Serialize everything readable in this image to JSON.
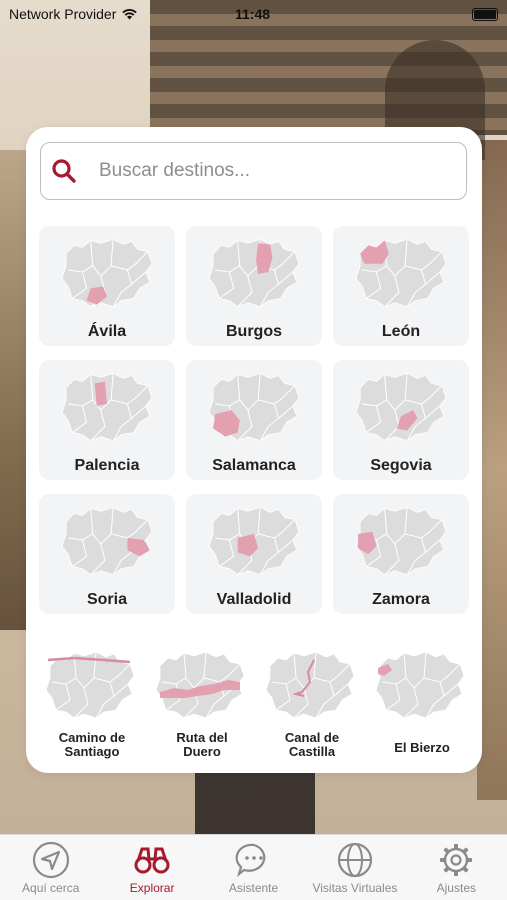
{
  "status_bar": {
    "carrier": "Network Provider",
    "time": "11:48"
  },
  "search": {
    "placeholder": "Buscar destinos..."
  },
  "provinces": [
    {
      "label": "Ávila"
    },
    {
      "label": "Burgos"
    },
    {
      "label": "León"
    },
    {
      "label": "Palencia"
    },
    {
      "label": "Salamanca"
    },
    {
      "label": "Segovia"
    },
    {
      "label": "Soria"
    },
    {
      "label": "Valladolid"
    },
    {
      "label": "Zamora"
    }
  ],
  "routes": [
    {
      "label": "Camino de\nSantiago"
    },
    {
      "label": "Ruta del\nDuero"
    },
    {
      "label": "Canal de\nCastilla"
    },
    {
      "label": "El Bierzo"
    }
  ],
  "tabs": [
    {
      "label": "Aquí cerca",
      "icon": "navigation-arrow-icon"
    },
    {
      "label": "Explorar",
      "icon": "binoculars-icon",
      "active": true
    },
    {
      "label": "Asistente",
      "icon": "chat-bubble-icon"
    },
    {
      "label": "Visitas Virtuales",
      "icon": "globe-icon"
    },
    {
      "label": "Ajustes",
      "icon": "gear-icon"
    }
  ],
  "colors": {
    "accent": "#a6192e",
    "highlight": "#e3a0b0",
    "map_base": "#dcdcdc",
    "tile_bg": "#f3f4f6"
  }
}
